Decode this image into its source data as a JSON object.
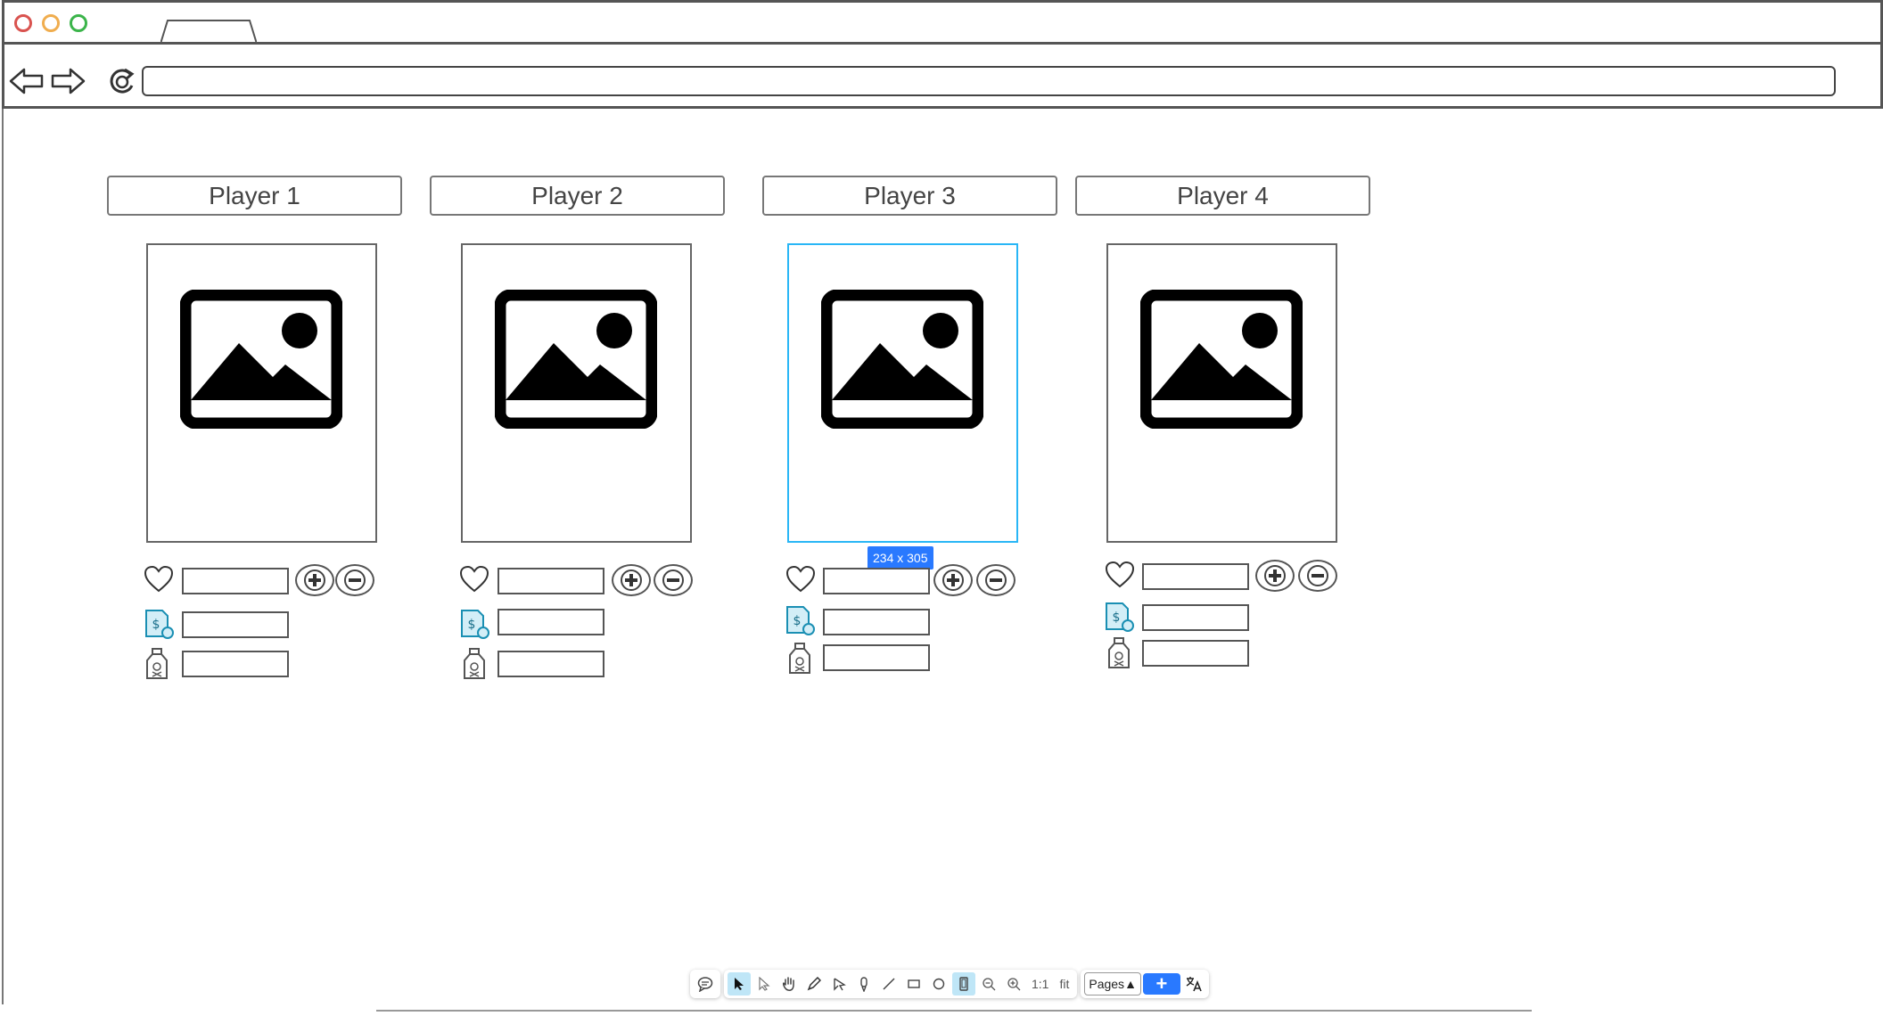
{
  "browser": {
    "url": "",
    "traffic_lights": {
      "close": "#d9534f",
      "minimize": "#f0ad4e",
      "maximize": "#3bb44a"
    }
  },
  "players": [
    {
      "name": "Player 1",
      "health": "",
      "money": "",
      "potion": ""
    },
    {
      "name": "Player 2",
      "health": "",
      "money": "",
      "potion": ""
    },
    {
      "name": "Player 3",
      "health": "",
      "money": "",
      "potion": ""
    },
    {
      "name": "Player 4",
      "health": "",
      "money": "",
      "potion": ""
    }
  ],
  "selection": {
    "size_label": "234 x 305"
  },
  "toolbar": {
    "zoom_reset": "1:1",
    "fit": "fit",
    "pages_label": "Pages",
    "add_label": "+",
    "accent": "#2979ff"
  }
}
